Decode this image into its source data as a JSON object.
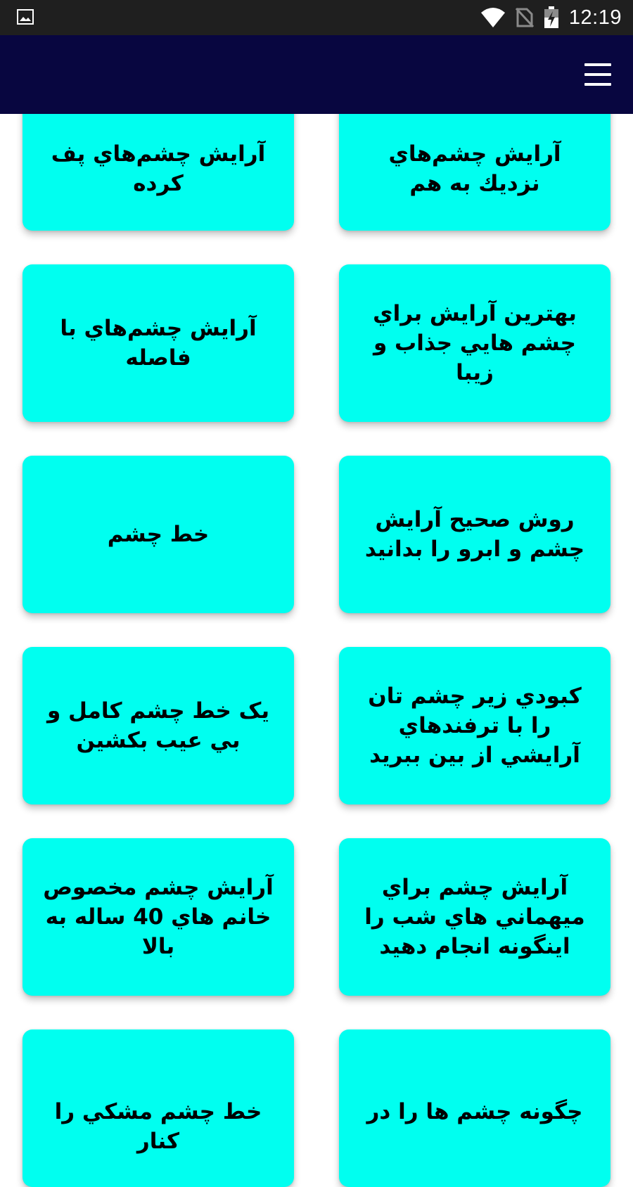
{
  "status_bar": {
    "time": "12:19",
    "icons": [
      "image-icon",
      "wifi-icon",
      "no-sim-icon",
      "battery-charging-icon"
    ]
  },
  "app_bar": {
    "menu_icon": "hamburger-menu-icon",
    "background": "#080640"
  },
  "card_color": "#00fff0",
  "cards": [
    {
      "label": "آرایش چشم‌هاي نزديك به هم"
    },
    {
      "label": "آرايش چشم‌هاي پف كرده"
    },
    {
      "label": "بهترين آرايش براي چشم هايي جذاب و زيبا"
    },
    {
      "label": "آرايش چشم‌هاي با فاصله"
    },
    {
      "label": "روش صحيح آرايش چشم و ابرو را بدانيد"
    },
    {
      "label": "خط چشم"
    },
    {
      "label": "كبودي زير چشم تان را با ترفندهاي آرايشي از بين ببريد"
    },
    {
      "label": "یک خط چشم کامل و بي عيب بکشين"
    },
    {
      "label": "آرايش چشم براي ميهماني هاي شب را اينگونه انجام دهيد"
    },
    {
      "label": "آرايش چشم مخصوص خانم هاي 40 ساله به بالا"
    },
    {
      "label": "چگونه چشم ها را در"
    },
    {
      "label": "خط چشم مشكي را كنار"
    }
  ]
}
